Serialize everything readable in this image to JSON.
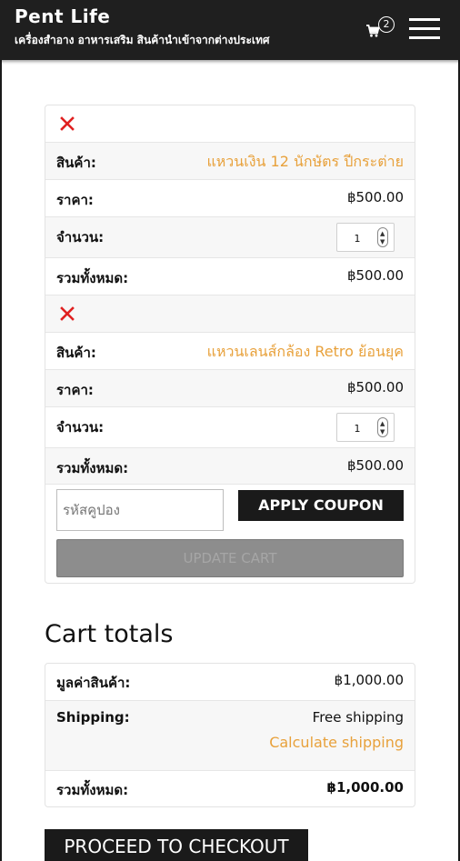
{
  "header": {
    "site_title": "Pent Life",
    "tagline": "เครื่องสำอาง อาหารเสริม สินค้านำเข้าจากต่างประเทศ",
    "cart_count": "2"
  },
  "cart": {
    "items": [
      {
        "product_label": "สินค้า:",
        "product_name": "แหวนเงิน 12 นักษัตร ปีกระต่าย",
        "price_label": "ราคา:",
        "price": "฿500.00",
        "quantity_label": "จำนวน:",
        "quantity": "1",
        "subtotal_label": "รวมทั้งหมด:",
        "subtotal": "฿500.00"
      },
      {
        "product_label": "สินค้า:",
        "product_name": "แหวนเลนส์กล้อง Retro ย้อนยุค",
        "price_label": "ราคา:",
        "price": "฿500.00",
        "quantity_label": "จำนวน:",
        "quantity": "1",
        "subtotal_label": "รวมทั้งหมด:",
        "subtotal": "฿500.00"
      }
    ],
    "coupon_placeholder": "รหัสคูปอง",
    "apply_coupon_label": "APPLY COUPON",
    "update_cart_label": "UPDATE CART"
  },
  "totals": {
    "title": "Cart totals",
    "subtotal_label": "มูลค่าสินค้า:",
    "subtotal_value": "฿1,000.00",
    "shipping_label": "Shipping:",
    "shipping_value": "Free shipping",
    "calculate_shipping": "Calculate shipping",
    "total_label": "รวมทั้งหมด:",
    "total_value": "฿1,000.00"
  },
  "checkout_label": "PROCEED TO CHECKOUT",
  "colors": {
    "header_bg": "#1f1f1f",
    "accent_link": "#e8a13b",
    "remove_red": "#e02020",
    "button_dark": "#1a1a1a",
    "button_disabled": "#8d8d8d"
  }
}
